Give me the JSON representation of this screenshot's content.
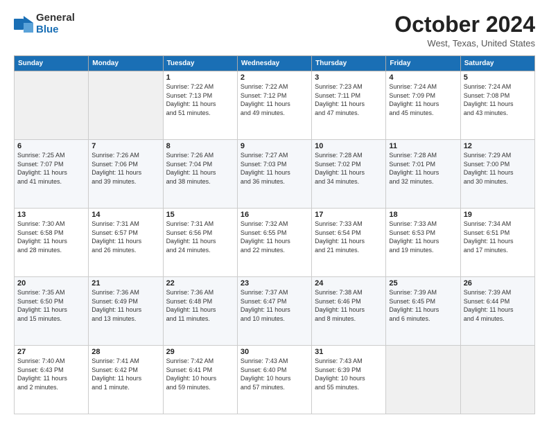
{
  "logo": {
    "general": "General",
    "blue": "Blue"
  },
  "title": "October 2024",
  "location": "West, Texas, United States",
  "days_of_week": [
    "Sunday",
    "Monday",
    "Tuesday",
    "Wednesday",
    "Thursday",
    "Friday",
    "Saturday"
  ],
  "weeks": [
    [
      {
        "day": "",
        "info": ""
      },
      {
        "day": "",
        "info": ""
      },
      {
        "day": "1",
        "info": "Sunrise: 7:22 AM\nSunset: 7:13 PM\nDaylight: 11 hours\nand 51 minutes."
      },
      {
        "day": "2",
        "info": "Sunrise: 7:22 AM\nSunset: 7:12 PM\nDaylight: 11 hours\nand 49 minutes."
      },
      {
        "day": "3",
        "info": "Sunrise: 7:23 AM\nSunset: 7:11 PM\nDaylight: 11 hours\nand 47 minutes."
      },
      {
        "day": "4",
        "info": "Sunrise: 7:24 AM\nSunset: 7:09 PM\nDaylight: 11 hours\nand 45 minutes."
      },
      {
        "day": "5",
        "info": "Sunrise: 7:24 AM\nSunset: 7:08 PM\nDaylight: 11 hours\nand 43 minutes."
      }
    ],
    [
      {
        "day": "6",
        "info": "Sunrise: 7:25 AM\nSunset: 7:07 PM\nDaylight: 11 hours\nand 41 minutes."
      },
      {
        "day": "7",
        "info": "Sunrise: 7:26 AM\nSunset: 7:06 PM\nDaylight: 11 hours\nand 39 minutes."
      },
      {
        "day": "8",
        "info": "Sunrise: 7:26 AM\nSunset: 7:04 PM\nDaylight: 11 hours\nand 38 minutes."
      },
      {
        "day": "9",
        "info": "Sunrise: 7:27 AM\nSunset: 7:03 PM\nDaylight: 11 hours\nand 36 minutes."
      },
      {
        "day": "10",
        "info": "Sunrise: 7:28 AM\nSunset: 7:02 PM\nDaylight: 11 hours\nand 34 minutes."
      },
      {
        "day": "11",
        "info": "Sunrise: 7:28 AM\nSunset: 7:01 PM\nDaylight: 11 hours\nand 32 minutes."
      },
      {
        "day": "12",
        "info": "Sunrise: 7:29 AM\nSunset: 7:00 PM\nDaylight: 11 hours\nand 30 minutes."
      }
    ],
    [
      {
        "day": "13",
        "info": "Sunrise: 7:30 AM\nSunset: 6:58 PM\nDaylight: 11 hours\nand 28 minutes."
      },
      {
        "day": "14",
        "info": "Sunrise: 7:31 AM\nSunset: 6:57 PM\nDaylight: 11 hours\nand 26 minutes."
      },
      {
        "day": "15",
        "info": "Sunrise: 7:31 AM\nSunset: 6:56 PM\nDaylight: 11 hours\nand 24 minutes."
      },
      {
        "day": "16",
        "info": "Sunrise: 7:32 AM\nSunset: 6:55 PM\nDaylight: 11 hours\nand 22 minutes."
      },
      {
        "day": "17",
        "info": "Sunrise: 7:33 AM\nSunset: 6:54 PM\nDaylight: 11 hours\nand 21 minutes."
      },
      {
        "day": "18",
        "info": "Sunrise: 7:33 AM\nSunset: 6:53 PM\nDaylight: 11 hours\nand 19 minutes."
      },
      {
        "day": "19",
        "info": "Sunrise: 7:34 AM\nSunset: 6:51 PM\nDaylight: 11 hours\nand 17 minutes."
      }
    ],
    [
      {
        "day": "20",
        "info": "Sunrise: 7:35 AM\nSunset: 6:50 PM\nDaylight: 11 hours\nand 15 minutes."
      },
      {
        "day": "21",
        "info": "Sunrise: 7:36 AM\nSunset: 6:49 PM\nDaylight: 11 hours\nand 13 minutes."
      },
      {
        "day": "22",
        "info": "Sunrise: 7:36 AM\nSunset: 6:48 PM\nDaylight: 11 hours\nand 11 minutes."
      },
      {
        "day": "23",
        "info": "Sunrise: 7:37 AM\nSunset: 6:47 PM\nDaylight: 11 hours\nand 10 minutes."
      },
      {
        "day": "24",
        "info": "Sunrise: 7:38 AM\nSunset: 6:46 PM\nDaylight: 11 hours\nand 8 minutes."
      },
      {
        "day": "25",
        "info": "Sunrise: 7:39 AM\nSunset: 6:45 PM\nDaylight: 11 hours\nand 6 minutes."
      },
      {
        "day": "26",
        "info": "Sunrise: 7:39 AM\nSunset: 6:44 PM\nDaylight: 11 hours\nand 4 minutes."
      }
    ],
    [
      {
        "day": "27",
        "info": "Sunrise: 7:40 AM\nSunset: 6:43 PM\nDaylight: 11 hours\nand 2 minutes."
      },
      {
        "day": "28",
        "info": "Sunrise: 7:41 AM\nSunset: 6:42 PM\nDaylight: 11 hours\nand 1 minute."
      },
      {
        "day": "29",
        "info": "Sunrise: 7:42 AM\nSunset: 6:41 PM\nDaylight: 10 hours\nand 59 minutes."
      },
      {
        "day": "30",
        "info": "Sunrise: 7:43 AM\nSunset: 6:40 PM\nDaylight: 10 hours\nand 57 minutes."
      },
      {
        "day": "31",
        "info": "Sunrise: 7:43 AM\nSunset: 6:39 PM\nDaylight: 10 hours\nand 55 minutes."
      },
      {
        "day": "",
        "info": ""
      },
      {
        "day": "",
        "info": ""
      }
    ]
  ]
}
